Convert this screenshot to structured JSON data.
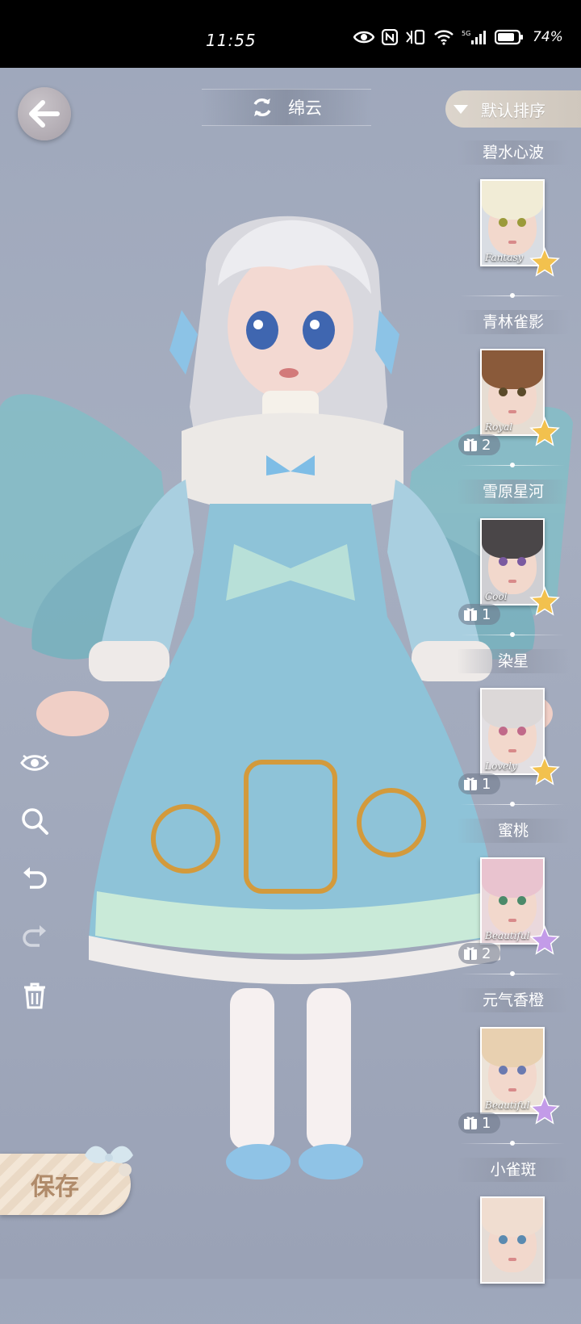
{
  "status_bar": {
    "time": "11:55",
    "battery": "74%"
  },
  "header": {
    "title": "绵云",
    "sort_label": "默认排序"
  },
  "hair_list": [
    {
      "name": "碧水心波",
      "tag": "Fantasy",
      "count": "",
      "star_color": "#f2c14e",
      "hair_color": "#f1ecd6",
      "eye_color": "#9b9a3a",
      "bg": "#d9dde3"
    },
    {
      "name": "青林雀影",
      "tag": "Royal",
      "count": "2",
      "star_color": "#f2c14e",
      "hair_color": "#8a5a3a",
      "eye_color": "#5a4a2a",
      "bg": "#e6ddd3"
    },
    {
      "name": "雪原星河",
      "tag": "Cool",
      "count": "1",
      "star_color": "#f2c14e",
      "hair_color": "#4a4648",
      "eye_color": "#7a5aa0",
      "bg": "#cfcfd3"
    },
    {
      "name": "染星",
      "tag": "Lovely",
      "count": "1",
      "star_color": "#f2c14e",
      "hair_color": "#dcd8d8",
      "eye_color": "#c06a8a",
      "bg": "#e2dfe2"
    },
    {
      "name": "蜜桃",
      "tag": "Beautiful",
      "count": "2",
      "star_color": "#c39be8",
      "hair_color": "#e9c3cf",
      "eye_color": "#4b8a6a",
      "bg": "#ead8dc"
    },
    {
      "name": "元气香橙",
      "tag": "Beautiful",
      "count": "1",
      "star_color": "#c39be8",
      "hair_color": "#e8d0b0",
      "eye_color": "#6a7ab0",
      "bg": "#ece3d8"
    },
    {
      "name": "小雀斑",
      "tag": "",
      "count": "",
      "star_color": "#f2c14e",
      "hair_color": "#f0ddd0",
      "eye_color": "#5a8ab0",
      "bg": "#e5dcd6"
    }
  ],
  "tools": [
    "eye-icon",
    "zoom-icon",
    "undo-icon",
    "redo-icon",
    "trash-icon"
  ],
  "save_label": "保存",
  "colors": {
    "dress": "#8ec3d8",
    "hair": "#e6e6ea",
    "wing": "#7fc0c8",
    "bg": "#a3abbe"
  }
}
